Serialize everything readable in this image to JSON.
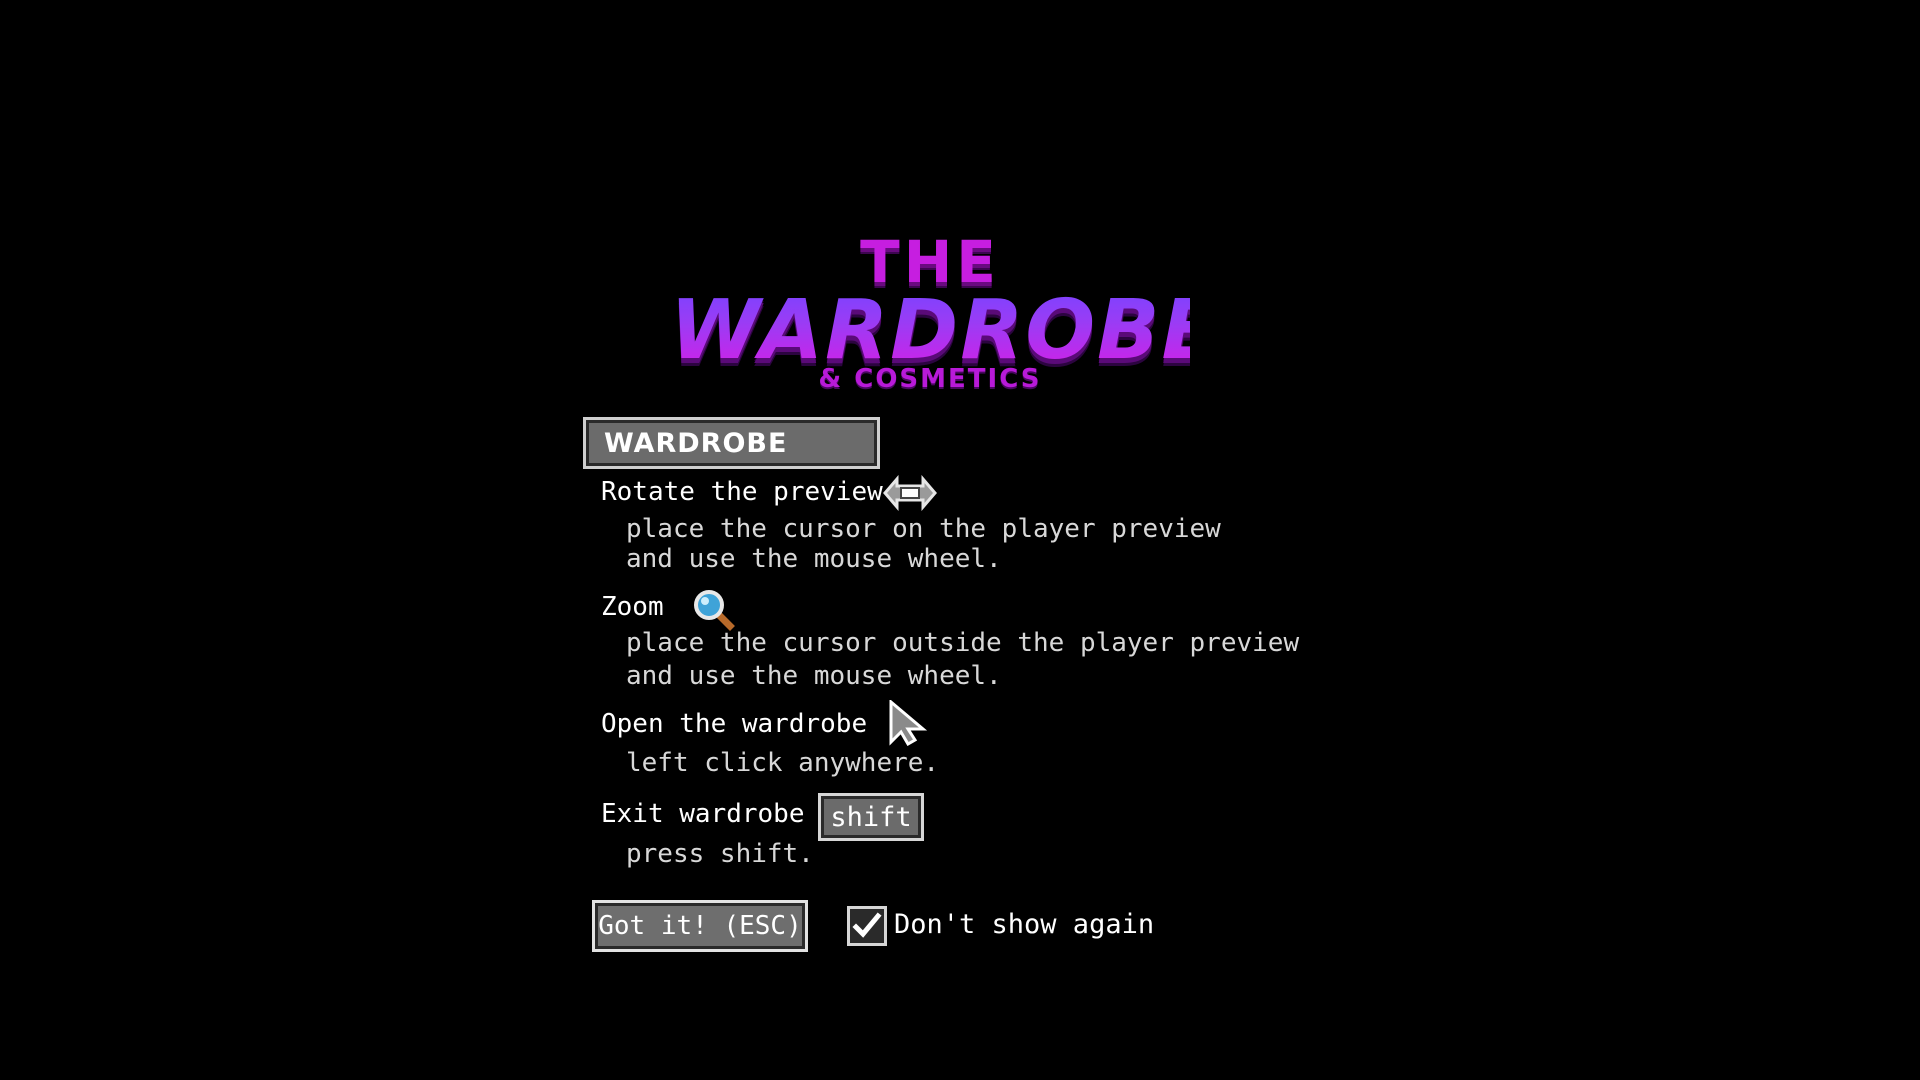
{
  "logo": {
    "the": "THE",
    "main": "WARDROBE",
    "sub": "& COSMETICS"
  },
  "section": {
    "title": "WARDROBE"
  },
  "instructions": {
    "rotate": {
      "title": "Rotate the preview",
      "line1": "place the cursor on the player preview",
      "line2": "and use the mouse wheel.",
      "icon": "rotate-arrows-icon"
    },
    "zoom": {
      "title": "Zoom",
      "line1": "place the cursor outside the player preview",
      "line2": "and use the mouse wheel.",
      "icon": "magnifier-icon"
    },
    "open": {
      "title": "Open the wardrobe",
      "line1": "left click anywhere.",
      "icon": "cursor-arrow-icon"
    },
    "exit": {
      "title": "Exit wardrobe",
      "key": "shift",
      "line1": "press shift."
    }
  },
  "controls": {
    "got_it": "Got it! (ESC)",
    "dont_show": "Don't show again",
    "dont_show_checked": true
  },
  "colors": {
    "background": "#000000",
    "logo_purple": "#c61ee0",
    "logo_blue": "#7b43ff",
    "button_gray": "#6b6b6b"
  }
}
